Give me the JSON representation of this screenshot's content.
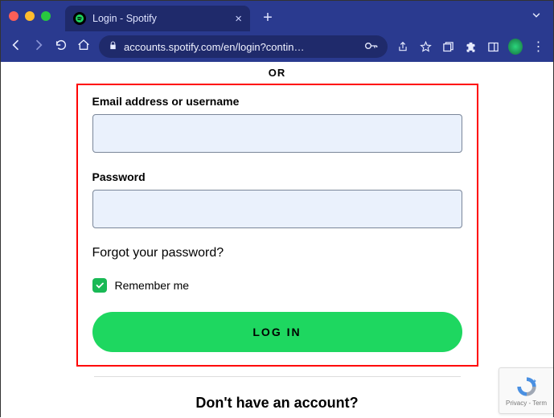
{
  "browser": {
    "tab_title": "Login - Spotify",
    "url": "accounts.spotify.com/en/login?contin…"
  },
  "page": {
    "or_divider": "OR",
    "email_label": "Email address or username",
    "email_value": "",
    "password_label": "Password",
    "password_value": "",
    "forgot_text": "Forgot your password?",
    "remember_checked": true,
    "remember_label": "Remember me",
    "login_button": "LOG IN",
    "signup_prompt": "Don't have an account?",
    "recaptcha_text": "Privacy - Term"
  }
}
